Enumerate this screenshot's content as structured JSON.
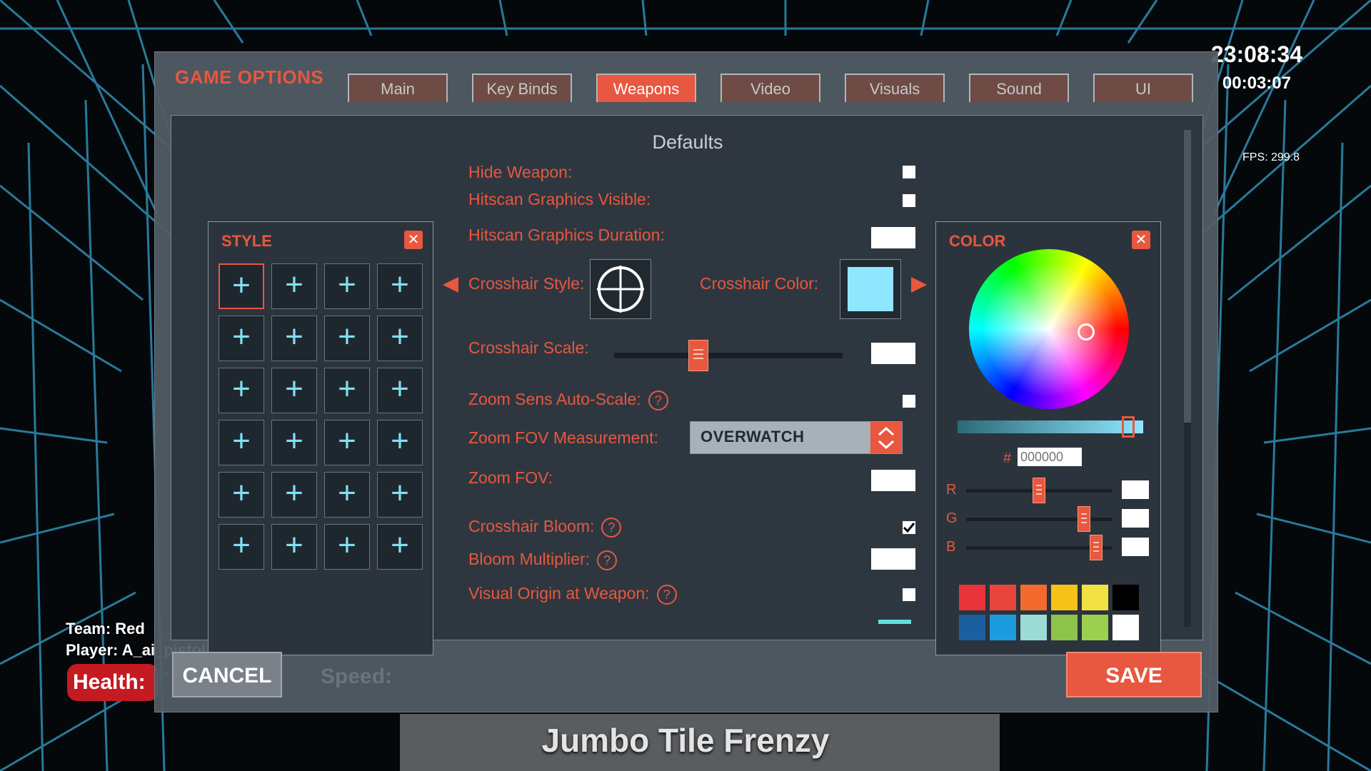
{
  "hud": {
    "clock": "23:08:34",
    "timer": "00:03:07",
    "fps": "FPS: 299.8",
    "team": "Team: Red",
    "player": "Player: A_ai_pistol_frozen",
    "health_label": "Health:",
    "game_title": "Jumbo Tile Frenzy"
  },
  "window": {
    "title": "GAME OPTIONS",
    "tabs": [
      {
        "label": "Main",
        "active": false
      },
      {
        "label": "Key Binds",
        "active": false
      },
      {
        "label": "Weapons",
        "active": true
      },
      {
        "label": "Video",
        "active": false
      },
      {
        "label": "Visuals",
        "active": false
      },
      {
        "label": "Sound",
        "active": false
      },
      {
        "label": "UI",
        "active": false
      }
    ],
    "section_title": "Defaults"
  },
  "style_panel": {
    "title": "STYLE",
    "close": "✕",
    "cell_glyph": "+"
  },
  "settings": {
    "hide_weapon": {
      "label": "Hide Weapon:",
      "checked": false
    },
    "hitscan_visible": {
      "label": "Hitscan Graphics Visible:",
      "checked": false
    },
    "hitscan_duration": {
      "label": "Hitscan Graphics Duration:",
      "value": ""
    },
    "crosshair_style": {
      "label": "Crosshair Style:"
    },
    "crosshair_color": {
      "label": "Crosshair Color:",
      "color": "#8fe6ff"
    },
    "crosshair_scale": {
      "label": "Crosshair Scale:",
      "value": "",
      "level": 0.37
    },
    "zoom_autoscale": {
      "label": "Zoom Sens Auto-Scale:",
      "help": "?",
      "checked": false
    },
    "zoom_fov_measure": {
      "label": "Zoom FOV Measurement:",
      "selected": "OVERWATCH"
    },
    "zoom_fov": {
      "label": "Zoom FOV:",
      "value": ""
    },
    "crosshair_bloom": {
      "label": "Crosshair Bloom:",
      "help": "?",
      "checked": true
    },
    "bloom_multiplier": {
      "label": "Bloom Multiplier:",
      "help": "?",
      "value": ""
    },
    "visual_origin": {
      "label": "Visual Origin at Weapon:",
      "help": "?",
      "checked": false
    }
  },
  "color_panel": {
    "title": "COLOR",
    "close": "✕",
    "hash": "#",
    "hex_placeholder": "000000",
    "hue_level": 0.92,
    "channels": [
      {
        "label": "R",
        "level": 0.5
      },
      {
        "label": "G",
        "level": 0.81
      },
      {
        "label": "B",
        "level": 0.89
      }
    ],
    "swatches": [
      "#e8343a",
      "#e8453d",
      "#f26a2e",
      "#f6c21a",
      "#f3e043",
      "#000000",
      "#1c5fa0",
      "#1d9be0",
      "#9ddbd6",
      "#8dc24b",
      "#9dcf4f",
      "#ffffff"
    ]
  },
  "footer": {
    "cancel": "CANCEL",
    "speed_placeholder": "Speed:",
    "save": "SAVE"
  },
  "colors": {
    "accent": "#e8573f",
    "cyan": "#7fe1f5",
    "panel": "#2e3740"
  }
}
